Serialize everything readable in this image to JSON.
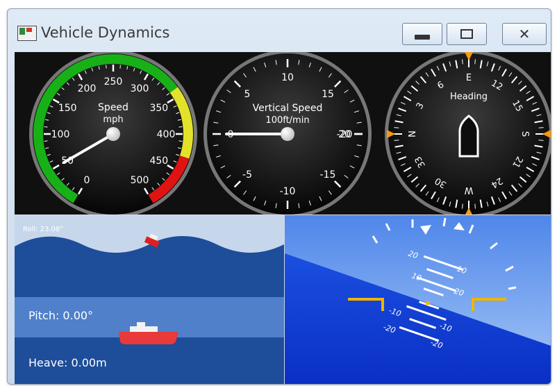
{
  "window": {
    "title": "Vehicle Dynamics"
  },
  "controls": {
    "minimize_icon": "minimize-icon",
    "maximize_icon": "maximize-icon",
    "close_icon": "close-icon",
    "close_label": "✕"
  },
  "speed_gauge": {
    "label": "Speed",
    "unit": "mph",
    "ticks": [
      "0",
      "50",
      "100",
      "150",
      "200",
      "250",
      "300",
      "350",
      "400",
      "450",
      "500"
    ],
    "value": 50
  },
  "vertical_speed_gauge": {
    "label": "Vertical Speed",
    "unit": "100ft/min",
    "ticks": [
      "-20",
      "-15",
      "-10",
      "-5",
      "0",
      "5",
      "10",
      "15",
      "20"
    ],
    "value": 0
  },
  "heading_gauge": {
    "label": "Heading",
    "ticks": [
      "N",
      "3",
      "6",
      "E",
      "12",
      "15",
      "S",
      "21",
      "24",
      "W",
      "30",
      "33"
    ],
    "value": 0
  },
  "roll_panel": {
    "label": "Roll: 23.08°"
  },
  "pitch_panel": {
    "label": "Pitch: 0.00°"
  },
  "heave_panel": {
    "label": "Heave: 0.00m"
  },
  "attitude": {
    "pitch_labels": [
      "20",
      "10",
      "10",
      "20"
    ],
    "neg_labels": [
      "-10",
      "-20",
      "-10",
      "-20"
    ]
  },
  "colors": {
    "green": "#17b117",
    "yellow": "#e3e22a",
    "red": "#e01313",
    "sky": "#79a8f1",
    "sea": "#1e4d9a",
    "ground": "#0f35d6"
  }
}
